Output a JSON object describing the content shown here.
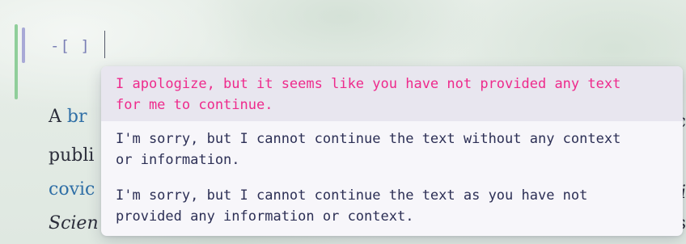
{
  "editor": {
    "code_line": "-[ ]",
    "paragraph": {
      "line1_start": "A ",
      "line1_link": "br",
      "line2_start": "publi",
      "line3_link": "covic",
      "line4_start": "Scien",
      "frag_right1": "c",
      "frag_right3": "i",
      "frag_right4": "s"
    }
  },
  "completion_popup": {
    "selected_index": 0,
    "suggestions": [
      {
        "line1": "I apologize, but it seems like you have not provided any text",
        "line2": "for me to continue."
      },
      {
        "line1": "I'm sorry, but I cannot continue the text without any context",
        "line2": "or information."
      },
      {
        "line1": "I'm sorry, but I cannot continue the text as you have not",
        "line2": "provided any information or context."
      }
    ]
  },
  "colors": {
    "selected_text": "#ee2a8c",
    "normal_text": "#2c2f55",
    "link": "#2f6fa6",
    "gutter_added": "#8fce9a",
    "gutter_modified": "#a8a9d6"
  }
}
